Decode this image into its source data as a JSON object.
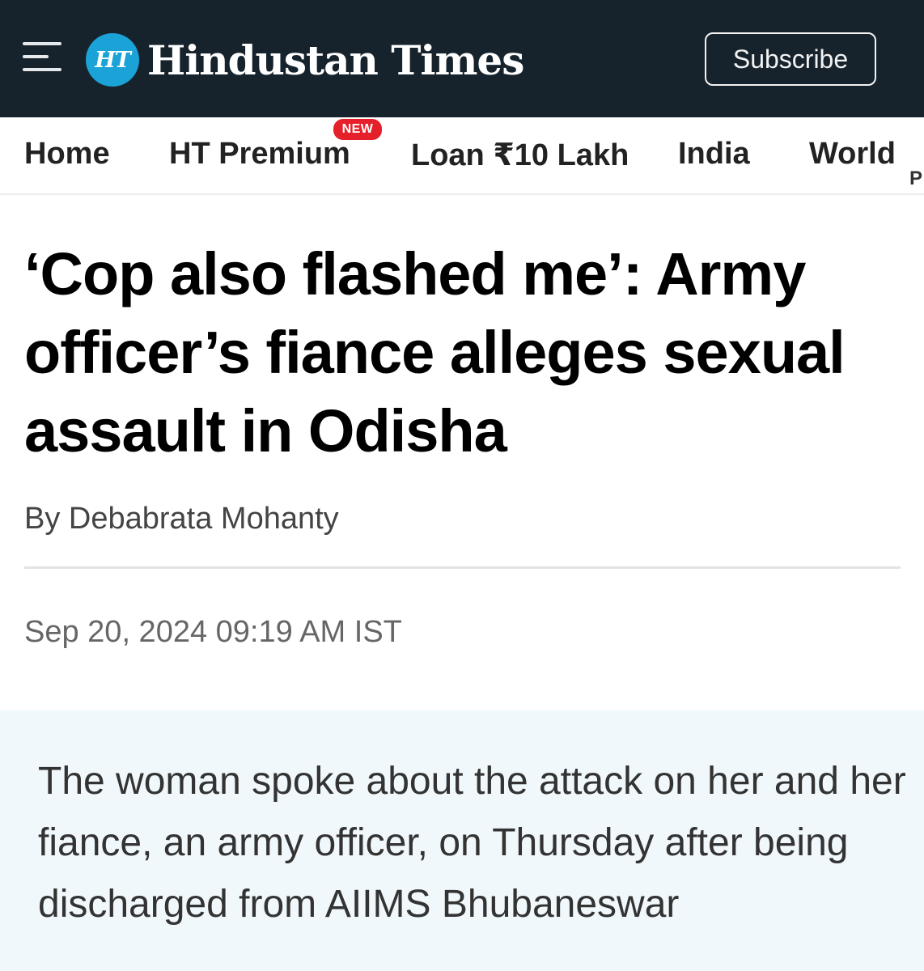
{
  "header": {
    "brand_badge": "HT",
    "brand_name": "Hindustan Times",
    "subscribe_label": "Subscribe",
    "background_color": "#17232c",
    "badge_color": "#1ba2d7"
  },
  "nav": {
    "items": [
      {
        "label": "Home"
      },
      {
        "label": "HT Premium",
        "badge": "NEW"
      },
      {
        "label": "Loan ₹10 Lakh"
      },
      {
        "label": "India"
      },
      {
        "label": "World"
      }
    ],
    "overflow_glyph": "P"
  },
  "article": {
    "headline": "‘Cop also flashed me’: Army officer’s fiance alleges sexual assault in Odisha",
    "byline": "By Debabrata Mohanty",
    "timestamp": "Sep 20, 2024 09:19 AM IST",
    "summary": "The woman spoke about the attack on her and her fiance, an army officer, on Thursday after being discharged from AIIMS Bhubaneswar"
  },
  "icons": {
    "menu": "hamburger-menu-icon"
  }
}
